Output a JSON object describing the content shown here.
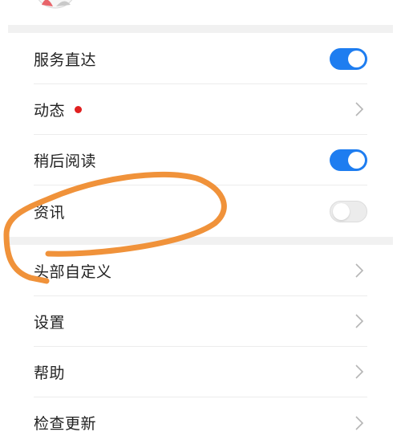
{
  "settings": {
    "items": [
      {
        "label": "服务直达",
        "control": "toggle",
        "state": "on"
      },
      {
        "label": "动态",
        "control": "chevron",
        "badge": "red-dot"
      },
      {
        "label": "稍后阅读",
        "control": "toggle",
        "state": "on"
      },
      {
        "label": "资讯",
        "control": "toggle",
        "state": "off"
      },
      {
        "label": "头部自定义",
        "control": "chevron"
      },
      {
        "label": "设置",
        "control": "chevron"
      },
      {
        "label": "帮助",
        "control": "chevron"
      },
      {
        "label": "检查更新",
        "control": "chevron"
      }
    ]
  },
  "colors": {
    "accent": "#1e7df0",
    "badge": "#e02020",
    "annotation": "#f0923a",
    "separator": "#f1f1f1"
  }
}
